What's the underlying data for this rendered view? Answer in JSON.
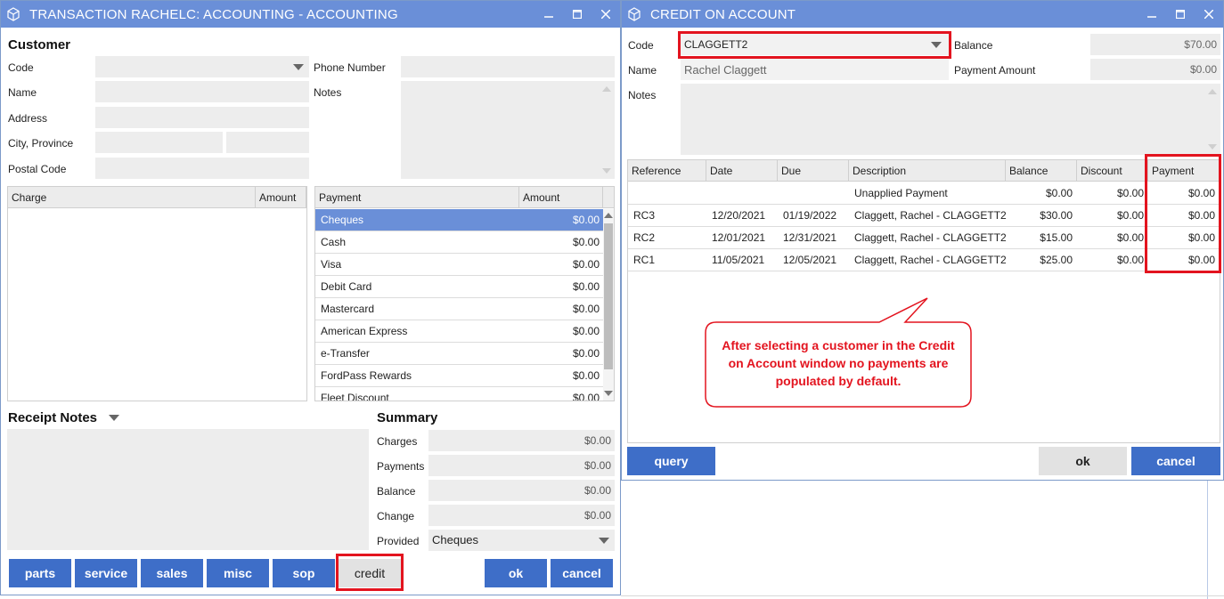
{
  "left_window": {
    "title": "TRANSACTION RACHELC: ACCOUNTING - ACCOUNTING",
    "customer": {
      "heading": "Customer",
      "code_label": "Code",
      "name_label": "Name",
      "address_label": "Address",
      "city_label": "City, Province",
      "postal_label": "Postal Code",
      "phone_label": "Phone Number",
      "notes_label": "Notes"
    },
    "charge_table": {
      "col_charge": "Charge",
      "col_amount": "Amount"
    },
    "payment_table": {
      "col_payment": "Payment",
      "col_amount": "Amount",
      "rows": [
        {
          "name": "Cheques",
          "amount": "$0.00"
        },
        {
          "name": "Cash",
          "amount": "$0.00"
        },
        {
          "name": "Visa",
          "amount": "$0.00"
        },
        {
          "name": "Debit Card",
          "amount": "$0.00"
        },
        {
          "name": "Mastercard",
          "amount": "$0.00"
        },
        {
          "name": "American Express",
          "amount": "$0.00"
        },
        {
          "name": "e-Transfer",
          "amount": "$0.00"
        },
        {
          "name": "FordPass Rewards",
          "amount": "$0.00"
        },
        {
          "name": "Fleet Discount",
          "amount": "$0.00"
        }
      ]
    },
    "receipt_notes_label": "Receipt Notes",
    "summary": {
      "heading": "Summary",
      "charges_label": "Charges",
      "charges_value": "$0.00",
      "payments_label": "Payments",
      "payments_value": "$0.00",
      "balance_label": "Balance",
      "balance_value": "$0.00",
      "change_label": "Change",
      "change_value": "$0.00",
      "provided_label": "Provided",
      "provided_value": "Cheques"
    },
    "buttons": {
      "parts": "parts",
      "service": "service",
      "sales": "sales",
      "misc": "misc",
      "sop": "sop",
      "credit": "credit",
      "ok": "ok",
      "cancel": "cancel"
    }
  },
  "right_window": {
    "title": "CREDIT ON ACCOUNT",
    "code_label": "Code",
    "code_value": "CLAGGETT2",
    "name_label": "Name",
    "name_value": "Rachel Claggett",
    "notes_label": "Notes",
    "balance_label": "Balance",
    "balance_value": "$70.00",
    "payment_amount_label": "Payment Amount",
    "payment_amount_value": "$0.00",
    "table": {
      "columns": [
        "Reference",
        "Date",
        "Due",
        "Description",
        "Balance",
        "Discount",
        "Payment"
      ],
      "rows": [
        {
          "reference": "",
          "date": "",
          "due": "",
          "description": "Unapplied Payment",
          "balance": "$0.00",
          "discount": "$0.00",
          "payment": "$0.00"
        },
        {
          "reference": "RC3",
          "date": "12/20/2021",
          "due": "01/19/2022",
          "description": "Claggett, Rachel - CLAGGETT2",
          "balance": "$30.00",
          "discount": "$0.00",
          "payment": "$0.00"
        },
        {
          "reference": "RC2",
          "date": "12/01/2021",
          "due": "12/31/2021",
          "description": "Claggett, Rachel - CLAGGETT2",
          "balance": "$15.00",
          "discount": "$0.00",
          "payment": "$0.00"
        },
        {
          "reference": "RC1",
          "date": "11/05/2021",
          "due": "12/05/2021",
          "description": "Claggett, Rachel - CLAGGETT2",
          "balance": "$25.00",
          "discount": "$0.00",
          "payment": "$0.00"
        }
      ]
    },
    "callout": "After selecting a customer in the Credit on Account window no payments are populated by default.",
    "buttons": {
      "query": "query",
      "ok": "ok",
      "cancel": "cancel"
    }
  },
  "colors": {
    "titlebar": "#6a8fd8",
    "button": "#3e6ec8",
    "highlight": "#e3141f",
    "field": "#ededed"
  },
  "icons": [
    "cube-icon",
    "minimize-icon",
    "maximize-icon",
    "close-icon",
    "chevron-down-icon"
  ]
}
